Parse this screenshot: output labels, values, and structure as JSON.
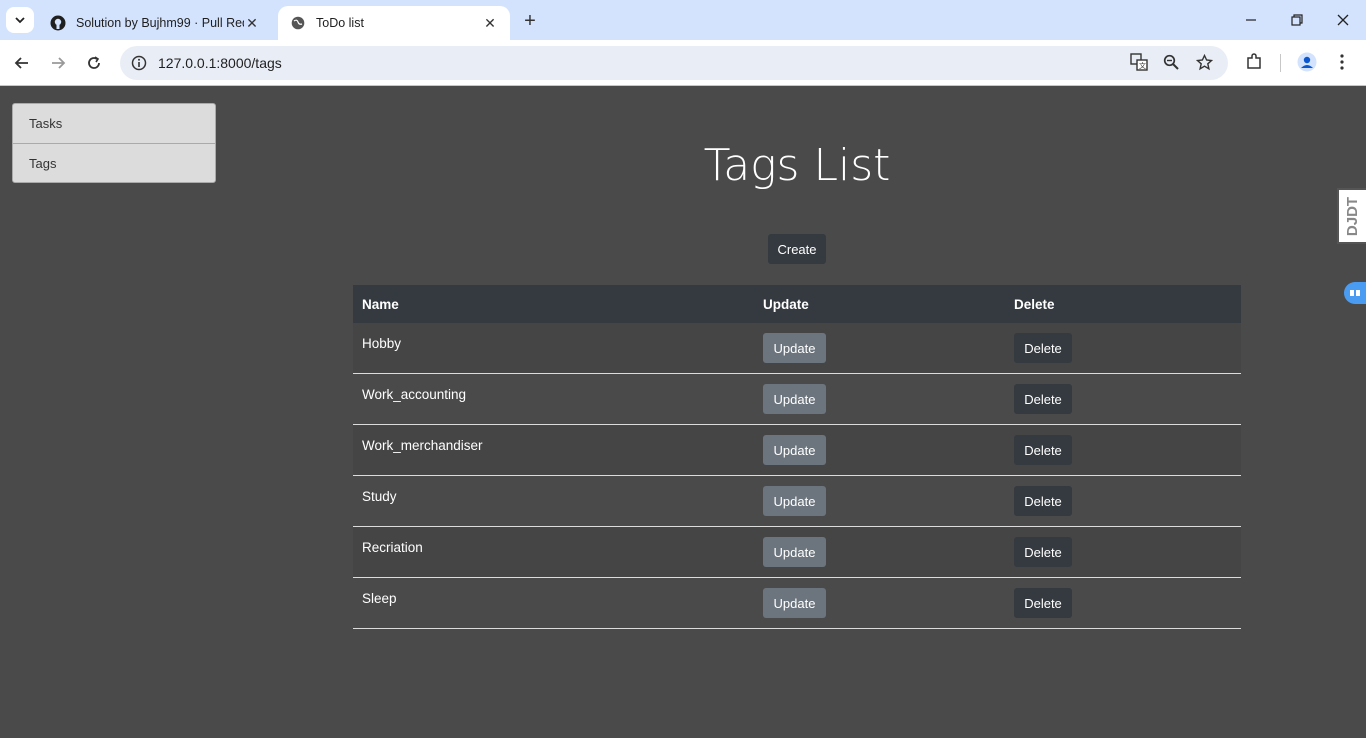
{
  "browser": {
    "tabs": [
      {
        "title": "Solution by Bujhm99 · Pull Requ",
        "active": false,
        "icon": "github-icon"
      },
      {
        "title": "ToDo list",
        "active": true,
        "icon": "globe-icon"
      }
    ],
    "url": "127.0.0.1:8000/tags"
  },
  "sidebar": {
    "items": [
      {
        "label": "Tasks"
      },
      {
        "label": "Tags"
      }
    ]
  },
  "main": {
    "title": "Tags List",
    "create_label": "Create",
    "table": {
      "headers": [
        "Name",
        "Update",
        "Delete"
      ],
      "rows": [
        {
          "name": "Hobby",
          "update": "Update",
          "delete": "Delete"
        },
        {
          "name": "Work_accounting",
          "update": "Update",
          "delete": "Delete"
        },
        {
          "name": "Work_merchandiser",
          "update": "Update",
          "delete": "Delete"
        },
        {
          "name": "Study",
          "update": "Update",
          "delete": "Delete"
        },
        {
          "name": "Recriation",
          "update": "Update",
          "delete": "Delete"
        },
        {
          "name": "Sleep",
          "update": "Update",
          "delete": "Delete"
        }
      ]
    }
  },
  "debug_toolbar": {
    "label": "DJDT"
  },
  "colors": {
    "page_bg": "#4a4a4a",
    "dark_button": "#343a40",
    "secondary_button": "#6c757d"
  }
}
